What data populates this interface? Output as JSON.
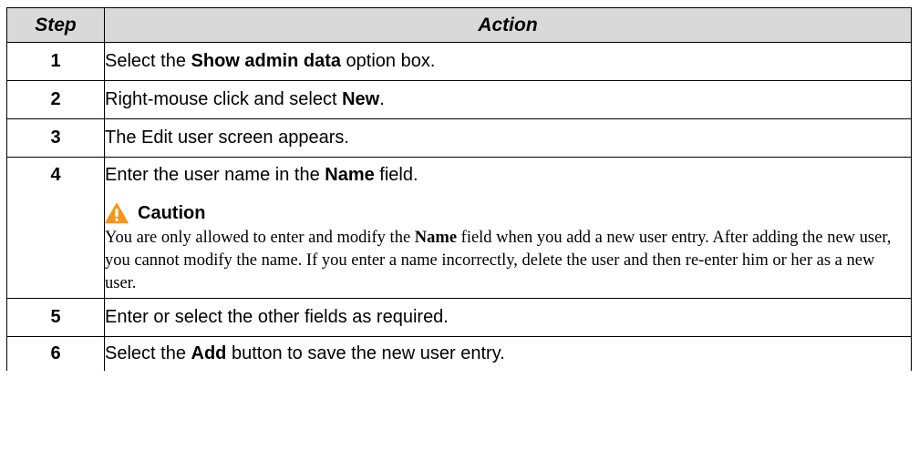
{
  "table": {
    "headers": {
      "step": "Step",
      "action": "Action"
    },
    "rows": [
      {
        "step": "1",
        "pre": "Select the ",
        "bold": "Show admin data",
        "post": " option box."
      },
      {
        "step": "2",
        "pre": "Right-mouse click and select ",
        "bold": "New",
        "post": "."
      },
      {
        "step": "3",
        "text": "The Edit user screen appears."
      },
      {
        "step": "4",
        "pre": "Enter the user name in the ",
        "bold": "Name",
        "post": " field.",
        "caution": {
          "icon": "warning-triangle-icon",
          "icon_color": "#f7941d",
          "title": "Caution",
          "pre": "You are only allowed to enter and modify the ",
          "bold": "Name",
          "post": " field when you add a new user entry. After adding the new user, you cannot modify the name. If you enter a name incorrectly, delete the user and then re-enter him or her as a new user."
        }
      },
      {
        "step": "5",
        "text": "Enter or select the other fields as required."
      },
      {
        "step": "6",
        "pre": "Select the ",
        "bold": "Add",
        "post": " button to save the new user entry."
      }
    ]
  }
}
